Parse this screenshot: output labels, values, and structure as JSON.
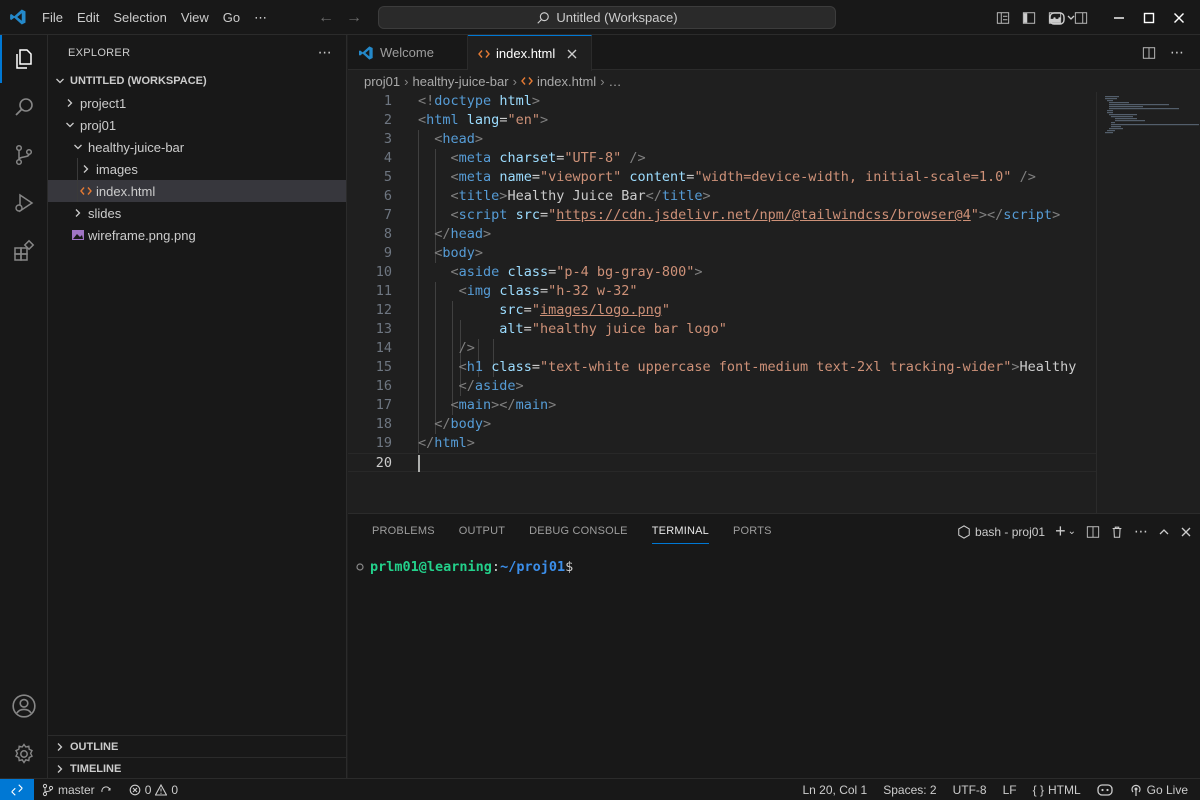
{
  "titlebar": {
    "menu": [
      "File",
      "Edit",
      "Selection",
      "View",
      "Go"
    ],
    "more": "⋯",
    "search_text": "Untitled (Workspace)"
  },
  "sidebar": {
    "title": "EXPLORER",
    "more": "⋯",
    "workspace": "UNTITLED (WORKSPACE)",
    "tree": [
      {
        "label": "project1",
        "depth": 0,
        "type": "folder-collapsed"
      },
      {
        "label": "proj01",
        "depth": 0,
        "type": "folder-expanded"
      },
      {
        "label": "healthy-juice-bar",
        "depth": 1,
        "type": "folder-expanded"
      },
      {
        "label": "images",
        "depth": 2,
        "type": "folder-collapsed"
      },
      {
        "label": "index.html",
        "depth": 2,
        "type": "html-file",
        "selected": true
      },
      {
        "label": "slides",
        "depth": 1,
        "type": "folder-collapsed"
      },
      {
        "label": "wireframe.png.png",
        "depth": 1,
        "type": "image-file"
      }
    ],
    "outline": "OUTLINE",
    "timeline": "TIMELINE"
  },
  "editor": {
    "tabs": [
      {
        "label": "Welcome",
        "active": false
      },
      {
        "label": "index.html",
        "active": true
      }
    ],
    "breadcrumb": [
      "proj01",
      "healthy-juice-bar",
      "index.html",
      "…"
    ],
    "line_numbers": [
      "1",
      "2",
      "3",
      "4",
      "5",
      "6",
      "7",
      "8",
      "9",
      "10",
      "11",
      "12",
      "13",
      "14",
      "15",
      "16",
      "17",
      "18",
      "19",
      "20"
    ],
    "lines": [
      [
        [
          "p",
          "<!"
        ],
        [
          "t",
          "doctype"
        ],
        [
          "tx",
          " "
        ],
        [
          "a",
          "html"
        ],
        [
          "p",
          ">"
        ]
      ],
      [
        [
          "p",
          "<"
        ],
        [
          "t",
          "html"
        ],
        [
          "tx",
          " "
        ],
        [
          "a",
          "lang"
        ],
        [
          "tx",
          "="
        ],
        [
          "s",
          "\"en\""
        ],
        [
          "p",
          ">"
        ]
      ],
      [
        [
          "tx",
          "  "
        ],
        [
          "p",
          "<"
        ],
        [
          "t",
          "head"
        ],
        [
          "p",
          ">"
        ]
      ],
      [
        [
          "tx",
          "    "
        ],
        [
          "p",
          "<"
        ],
        [
          "t",
          "meta"
        ],
        [
          "tx",
          " "
        ],
        [
          "a",
          "charset"
        ],
        [
          "tx",
          "="
        ],
        [
          "s",
          "\"UTF-8\""
        ],
        [
          "tx",
          " "
        ],
        [
          "p",
          "/>"
        ]
      ],
      [
        [
          "tx",
          "    "
        ],
        [
          "p",
          "<"
        ],
        [
          "t",
          "meta"
        ],
        [
          "tx",
          " "
        ],
        [
          "a",
          "name"
        ],
        [
          "tx",
          "="
        ],
        [
          "s",
          "\"viewport\""
        ],
        [
          "tx",
          " "
        ],
        [
          "a",
          "content"
        ],
        [
          "tx",
          "="
        ],
        [
          "s",
          "\"width=device-width, initial-scale=1.0\""
        ],
        [
          "tx",
          " "
        ],
        [
          "p",
          "/>"
        ]
      ],
      [
        [
          "tx",
          "    "
        ],
        [
          "p",
          "<"
        ],
        [
          "t",
          "title"
        ],
        [
          "p",
          ">"
        ],
        [
          "tx",
          "Healthy Juice Bar"
        ],
        [
          "p",
          "</"
        ],
        [
          "t",
          "title"
        ],
        [
          "p",
          ">"
        ]
      ],
      [
        [
          "tx",
          "    "
        ],
        [
          "p",
          "<"
        ],
        [
          "t",
          "script"
        ],
        [
          "tx",
          " "
        ],
        [
          "a",
          "src"
        ],
        [
          "tx",
          "="
        ],
        [
          "s",
          "\""
        ],
        [
          "su",
          "https://cdn.jsdelivr.net/npm/@tailwindcss/browser@4"
        ],
        [
          "s",
          "\""
        ],
        [
          "p",
          "></"
        ],
        [
          "t",
          "script"
        ],
        [
          "p",
          ">"
        ]
      ],
      [
        [
          "tx",
          "  "
        ],
        [
          "p",
          "</"
        ],
        [
          "t",
          "head"
        ],
        [
          "p",
          ">"
        ]
      ],
      [
        [
          "tx",
          "  "
        ],
        [
          "p",
          "<"
        ],
        [
          "t",
          "body"
        ],
        [
          "p",
          ">"
        ]
      ],
      [
        [
          "tx",
          "    "
        ],
        [
          "p",
          "<"
        ],
        [
          "t",
          "aside"
        ],
        [
          "tx",
          " "
        ],
        [
          "a",
          "class"
        ],
        [
          "tx",
          "="
        ],
        [
          "s",
          "\"p-4 bg-gray-800\""
        ],
        [
          "p",
          ">"
        ]
      ],
      [
        [
          "tx",
          "     "
        ],
        [
          "p",
          "<"
        ],
        [
          "t",
          "img"
        ],
        [
          "tx",
          " "
        ],
        [
          "a",
          "class"
        ],
        [
          "tx",
          "="
        ],
        [
          "s",
          "\"h-32 w-32\""
        ]
      ],
      [
        [
          "tx",
          "          "
        ],
        [
          "a",
          "src"
        ],
        [
          "tx",
          "="
        ],
        [
          "s",
          "\""
        ],
        [
          "su",
          "images/logo.png"
        ],
        [
          "s",
          "\""
        ]
      ],
      [
        [
          "tx",
          "          "
        ],
        [
          "a",
          "alt"
        ],
        [
          "tx",
          "="
        ],
        [
          "s",
          "\"healthy juice bar logo\""
        ]
      ],
      [
        [
          "tx",
          "     "
        ],
        [
          "p",
          "/>"
        ]
      ],
      [
        [
          "tx",
          "     "
        ],
        [
          "p",
          "<"
        ],
        [
          "t",
          "h1"
        ],
        [
          "tx",
          " "
        ],
        [
          "a",
          "class"
        ],
        [
          "tx",
          "="
        ],
        [
          "s",
          "\"text-white uppercase font-medium text-2xl tracking-wider\""
        ],
        [
          "p",
          ">"
        ],
        [
          "tx",
          "Healthy"
        ]
      ],
      [
        [
          "tx",
          "     "
        ],
        [
          "p",
          "</"
        ],
        [
          "t",
          "aside"
        ],
        [
          "p",
          ">"
        ]
      ],
      [
        [
          "tx",
          "    "
        ],
        [
          "p",
          "<"
        ],
        [
          "t",
          "main"
        ],
        [
          "p",
          "></"
        ],
        [
          "t",
          "main"
        ],
        [
          "p",
          ">"
        ]
      ],
      [
        [
          "tx",
          "  "
        ],
        [
          "p",
          "</"
        ],
        [
          "t",
          "body"
        ],
        [
          "p",
          ">"
        ]
      ],
      [
        [
          "p",
          "</"
        ],
        [
          "t",
          "html"
        ],
        [
          "p",
          ">"
        ]
      ],
      []
    ]
  },
  "panel": {
    "tabs": [
      "PROBLEMS",
      "OUTPUT",
      "DEBUG CONSOLE",
      "TERMINAL",
      "PORTS"
    ],
    "active_tab": "TERMINAL",
    "terminal_name": "bash - proj01",
    "prompt_user": "prlm01@learning",
    "prompt_sep": ":",
    "prompt_path": "~/proj01",
    "prompt_end": "$"
  },
  "statusbar": {
    "branch": "master",
    "errors": "0",
    "warnings": "0",
    "position": "Ln 20, Col 1",
    "spaces": "Spaces: 2",
    "encoding": "UTF-8",
    "eol": "LF",
    "language": "HTML",
    "golive": "Go Live"
  },
  "colors": {
    "accent": "#0078d4",
    "tag": "#569cd6",
    "attr": "#9cdcfe",
    "string": "#ce9178",
    "punct": "#808080",
    "prompt_user": "#23d18b",
    "prompt_path": "#3b8eea"
  }
}
